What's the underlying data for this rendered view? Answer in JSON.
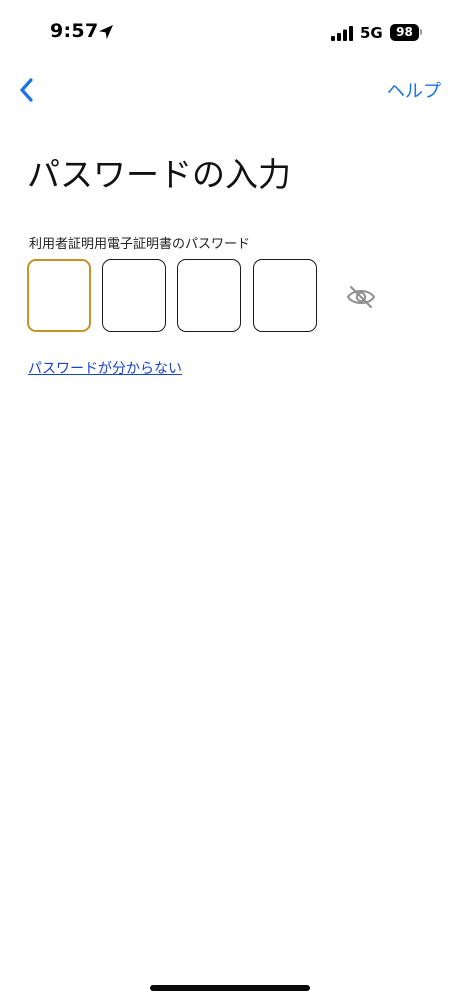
{
  "status_bar": {
    "time": "9:57",
    "location_icon": "location-arrow-icon",
    "signal_icon": "cellular-signal-icon",
    "network": "5G",
    "battery": "98"
  },
  "nav": {
    "back_icon": "chevron-left-icon",
    "help_label": "ヘルプ"
  },
  "page": {
    "title": "パスワードの入力",
    "field_label": "利用者証明用電子証明書のパスワード",
    "pin_digits": [
      "",
      "",
      "",
      ""
    ],
    "active_index": 0,
    "visibility_icon": "eye-slash-icon",
    "forgot_link": "パスワードが分からない"
  },
  "colors": {
    "accent": "#1a73e8",
    "link": "#1a43c8",
    "active_border": "#c8922b",
    "box_border": "#1b1b1b"
  }
}
